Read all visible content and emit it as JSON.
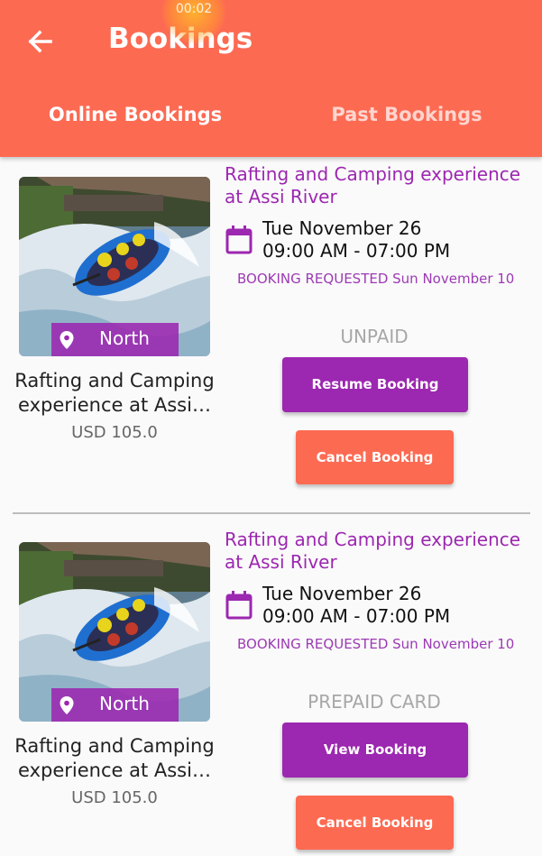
{
  "overlay": {
    "timer": "00:02"
  },
  "header": {
    "title": "Bookings",
    "tabs": [
      {
        "label": "Online Bookings",
        "active": true
      },
      {
        "label": "Past Bookings",
        "active": false
      }
    ]
  },
  "colors": {
    "appbar": "#fd6a52",
    "accent_purple": "#9c27b0",
    "cancel_orange": "#fd6a52",
    "muted_text": "#a7a7a7"
  },
  "bookings": [
    {
      "image": "rafting-photo",
      "location": "North",
      "name": "Rafting and Camping experience at Assi…",
      "price": "USD 105.0",
      "experience_title": "Rafting and Camping experience at Assi River",
      "date": "Tue November 26",
      "time": "09:00 AM - 07:00 PM",
      "status": "BOOKING REQUESTED  Sun November 10",
      "payment_status": "UNPAID",
      "primary_button": "Resume Booking",
      "cancel_button": "Cancel Booking"
    },
    {
      "image": "rafting-photo",
      "location": "North",
      "name": "Rafting and Camping experience at Assi…",
      "price": "USD 105.0",
      "experience_title": "Rafting and Camping experience at Assi River",
      "date": "Tue November 26",
      "time": "09:00 AM - 07:00 PM",
      "status": "BOOKING REQUESTED  Sun November 10",
      "payment_status": "PREPAID CARD",
      "primary_button": "View Booking",
      "cancel_button": "Cancel Booking"
    }
  ]
}
